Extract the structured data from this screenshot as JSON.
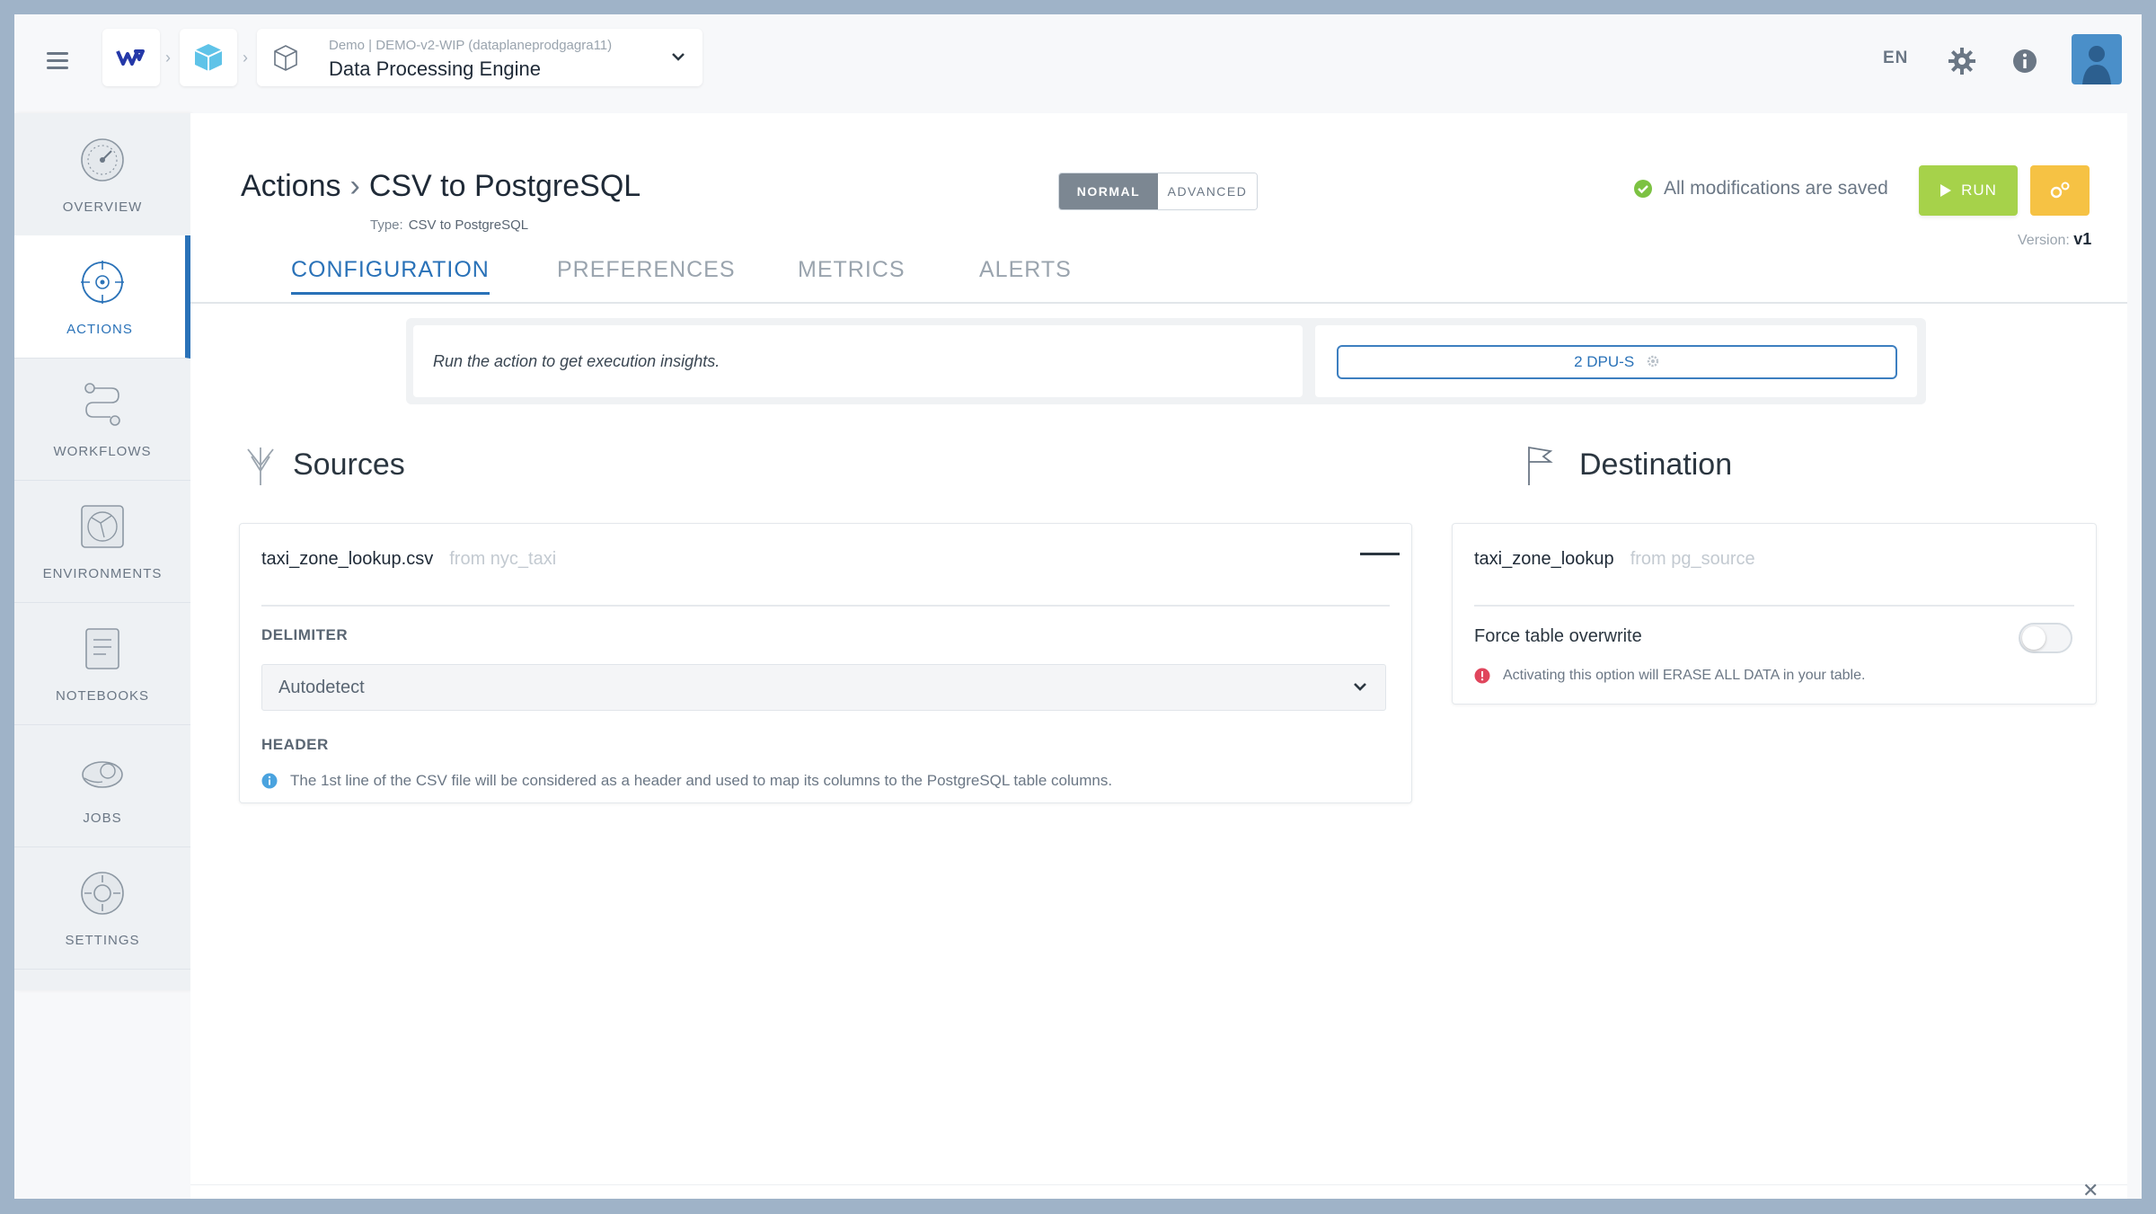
{
  "header": {
    "breadcrumb_sub": "Demo | DEMO-v2-WIP (dataplaneprodgagra11)",
    "engine_title": "Data Processing Engine",
    "language": "EN"
  },
  "sidebar": {
    "items": [
      {
        "label": "OVERVIEW",
        "icon": "overview-gauge-icon"
      },
      {
        "label": "ACTIONS",
        "icon": "actions-target-icon"
      },
      {
        "label": "WORKFLOWS",
        "icon": "workflows-icon"
      },
      {
        "label": "ENVIRONMENTS",
        "icon": "environments-icon"
      },
      {
        "label": "NOTEBOOKS",
        "icon": "notebooks-icon"
      },
      {
        "label": "JOBS",
        "icon": "jobs-icon"
      },
      {
        "label": "SETTINGS",
        "icon": "settings-icon"
      }
    ]
  },
  "page": {
    "crumb_root": "Actions",
    "title": "CSV to PostgreSQL",
    "type_label": "Type:",
    "type_value": "CSV to PostgreSQL",
    "mode_normal": "NORMAL",
    "mode_advanced": "ADVANCED",
    "saved_status": "All modifications are saved",
    "run_label": "RUN",
    "version_label": "Version:",
    "version_value": "v1"
  },
  "tabs": [
    {
      "label": "CONFIGURATION"
    },
    {
      "label": "PREFERENCES"
    },
    {
      "label": "METRICS"
    },
    {
      "label": "ALERTS"
    }
  ],
  "insights": {
    "message": "Run the action to get execution insights.",
    "dpu_label": "2 DPU-S"
  },
  "sources": {
    "title": "Sources",
    "file_name": "taxi_zone_lookup.csv",
    "from": "from nyc_taxi",
    "delimiter_label": "DELIMITER",
    "delimiter_value": "Autodetect",
    "header_label": "HEADER",
    "header_info": "The 1st line of the CSV file will be considered as a header and used to map its columns to the PostgreSQL table columns."
  },
  "destination": {
    "title": "Destination",
    "table_name": "taxi_zone_lookup",
    "from": "from pg_source",
    "overwrite_label": "Force table overwrite",
    "overwrite_enabled": false,
    "warning": "Activating this option will ERASE ALL DATA in your table."
  },
  "colors": {
    "accent": "#2a72b8",
    "run": "#a6d24a",
    "gear_button": "#f6c244",
    "success": "#7cc242",
    "danger": "#e0455c"
  }
}
